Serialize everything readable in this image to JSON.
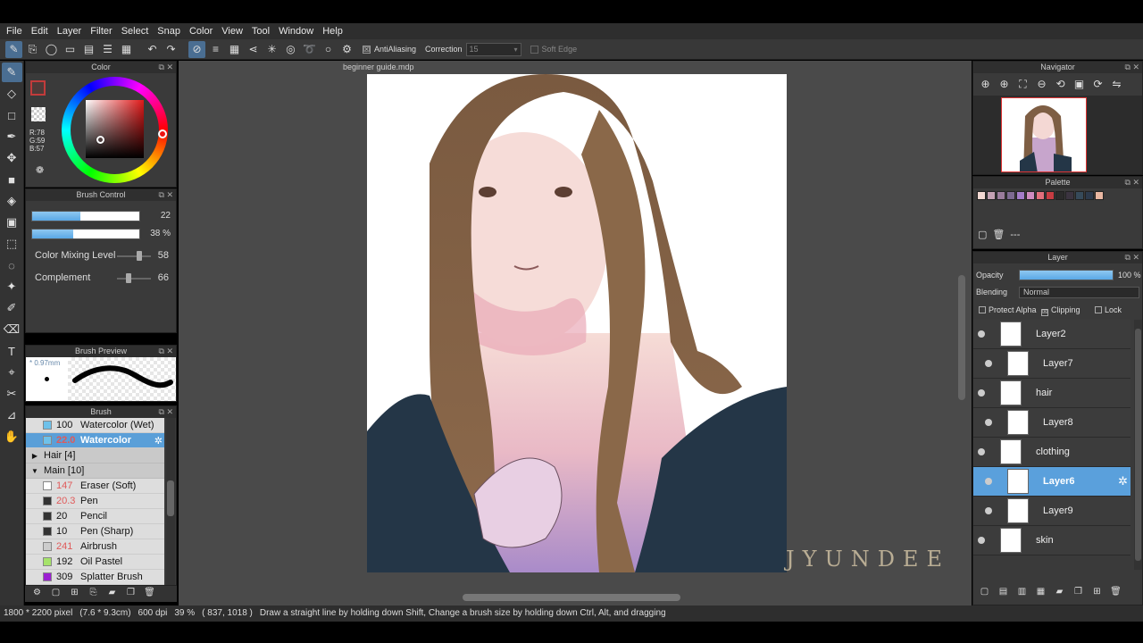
{
  "menu": [
    "File",
    "Edit",
    "Layer",
    "Filter",
    "Select",
    "Snap",
    "Color",
    "View",
    "Tool",
    "Window",
    "Help"
  ],
  "toolbar": {
    "antialiasing_label": "AntiAliasing",
    "antialiasing_checked": "☒",
    "correction_label": "Correction",
    "correction_value": "15",
    "soft_edge_label": "Soft Edge"
  },
  "color_panel": {
    "title": "Color",
    "r": "R:78",
    "g": "G:59",
    "b": "B:57",
    "fg_color": "#4e3b39"
  },
  "brush_control": {
    "title": "Brush Control",
    "size_value": "22",
    "size_fraction": 0.45,
    "opacity_value": "38 %",
    "opacity_fraction": 0.38,
    "mixing_label": "Color Mixing Level",
    "mixing_value": "58",
    "complement_label": "Complement",
    "complement_value": "66"
  },
  "brush_preview": {
    "title": "Brush Preview",
    "size_label": "* 0.97mm"
  },
  "brush_list": {
    "title": "Brush",
    "items": [
      {
        "type": "item",
        "num": "100",
        "name": "Watercolor (Wet)",
        "swatch": "#6ec1ea",
        "red": false
      },
      {
        "type": "item",
        "num": "22.0",
        "name": "Watercolor",
        "swatch": "#6ec1ea",
        "red": true,
        "selected": true
      },
      {
        "type": "group",
        "expanded": false,
        "name": "Hair [4]"
      },
      {
        "type": "group",
        "expanded": true,
        "name": "Main [10]"
      },
      {
        "type": "item",
        "num": "147",
        "name": "Eraser (Soft)",
        "swatch": "#ffffff",
        "red": true
      },
      {
        "type": "item",
        "num": "20.3",
        "name": "Pen",
        "swatch": "#333333",
        "red": true
      },
      {
        "type": "item",
        "num": "20",
        "name": "Pencil",
        "swatch": "#333333",
        "red": false
      },
      {
        "type": "item",
        "num": "10",
        "name": "Pen (Sharp)",
        "swatch": "#333333",
        "red": false
      },
      {
        "type": "item",
        "num": "241",
        "name": "Airbrush",
        "swatch": "#cccccc",
        "red": true
      },
      {
        "type": "item",
        "num": "192",
        "name": "Oil Pastel",
        "swatch": "#a6e36b",
        "red": false
      },
      {
        "type": "item",
        "num": "309",
        "name": "Splatter Brush",
        "swatch": "#9b1fd1",
        "red": false
      }
    ]
  },
  "document": {
    "tab_title": "beginner guide.mdp",
    "watermark": "JYUNDEE"
  },
  "statusbar": {
    "size": "1800 * 2200 pixel",
    "physical": "(7.6 * 9.3cm)",
    "dpi": "600 dpi",
    "zoom": "39 %",
    "coords": "( 837, 1018 )",
    "hint": "Draw a straight line by holding down Shift, Change a brush size by holding down Ctrl, Alt, and dragging"
  },
  "navigator": {
    "title": "Navigator"
  },
  "palette": {
    "title": "Palette",
    "colors": [
      "#f3d9d3",
      "#c4a2b4",
      "#9a7c9c",
      "#7d6a91",
      "#a47cc9",
      "#cf8bc0",
      "#e36f7c",
      "#c63c42",
      "#2b2b2b",
      "#3b3440",
      "#364a5a",
      "#2d3a4c",
      "#e9b7a2"
    ],
    "extra": "---"
  },
  "layer_panel": {
    "title": "Layer",
    "opacity_label": "Opacity",
    "opacity_value": "100 %",
    "opacity_fraction": 1.0,
    "blending_label": "Blending",
    "blending_value": "Normal",
    "protect_alpha": "Protect Alpha",
    "clipping": "Clipping",
    "lock": "Lock",
    "clipping_checked": "☒",
    "layers": [
      {
        "name": "Layer2",
        "clipped": false
      },
      {
        "name": "Layer7",
        "clipped": true
      },
      {
        "name": "hair",
        "clipped": false
      },
      {
        "name": "Layer8",
        "clipped": true
      },
      {
        "name": "clothing",
        "clipped": false
      },
      {
        "name": "Layer6",
        "clipped": true,
        "selected": true
      },
      {
        "name": "Layer9",
        "clipped": true
      },
      {
        "name": "skin",
        "clipped": false
      }
    ]
  },
  "colors": {
    "accent": "#5aa0dc",
    "panel": "#3a3a3a",
    "canvas_bg": "#4a4a4a"
  }
}
